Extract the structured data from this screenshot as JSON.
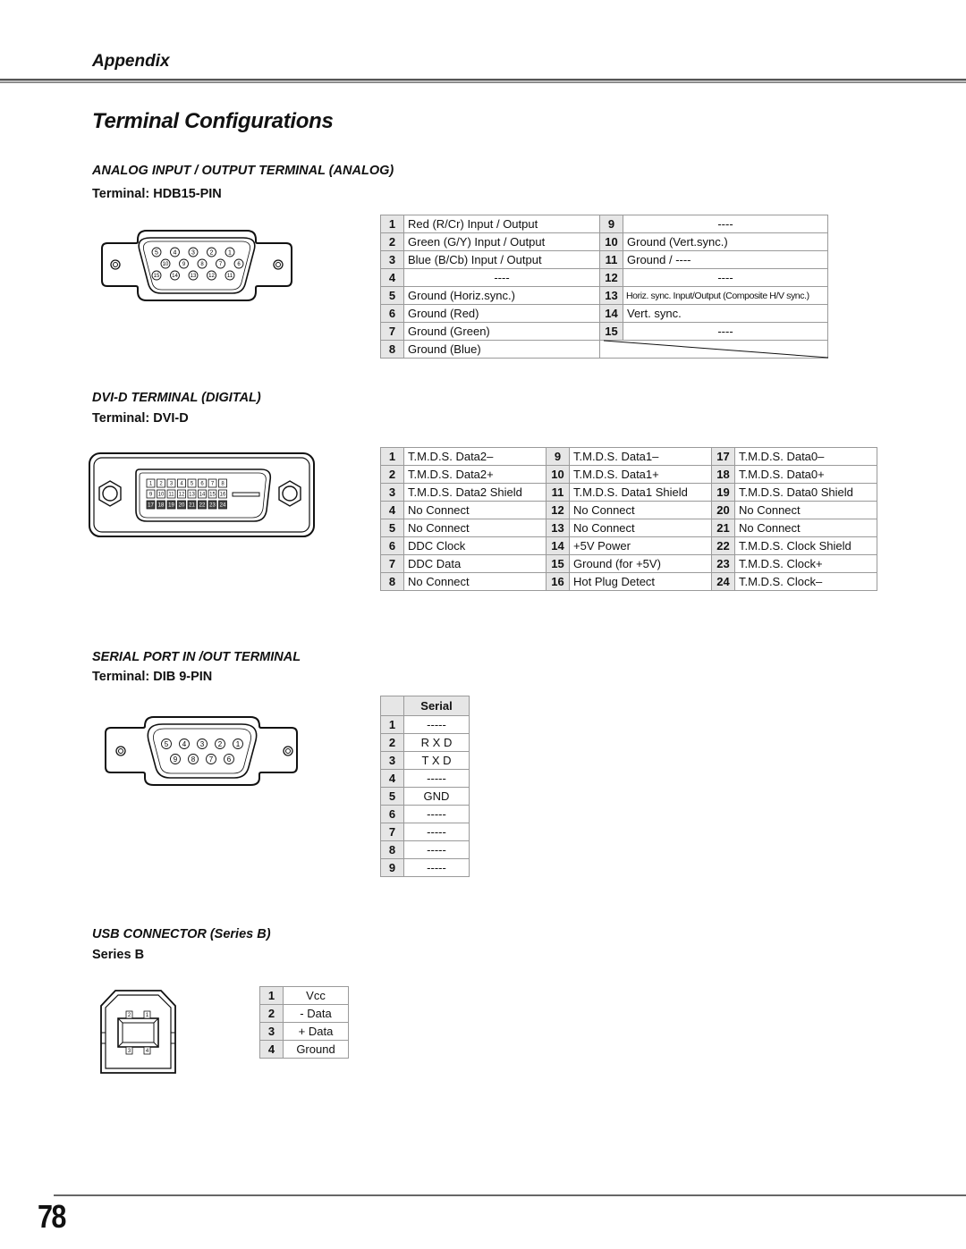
{
  "header": {
    "section": "Appendix",
    "page_title": "Terminal Configurations"
  },
  "analog": {
    "title": "ANALOG INPUT / OUTPUT TERMINAL (ANALOG)",
    "terminal": "Terminal: HDB15-PIN",
    "connector_pins_row1": [
      "5",
      "4",
      "3",
      "2",
      "1"
    ],
    "connector_pins_row2": [
      "10",
      "9",
      "8",
      "7",
      "6"
    ],
    "connector_pins_row3": [
      "15",
      "14",
      "13",
      "12",
      "11"
    ],
    "pins": [
      {
        "num": "1",
        "desc": "Red (R/Cr) Input / Output"
      },
      {
        "num": "2",
        "desc": "Green (G/Y) Input / Output"
      },
      {
        "num": "3",
        "desc": "Blue (B/Cb) Input / Output"
      },
      {
        "num": "4",
        "desc": "----"
      },
      {
        "num": "5",
        "desc": "Ground (Horiz.sync.)"
      },
      {
        "num": "6",
        "desc": "Ground (Red)"
      },
      {
        "num": "7",
        "desc": "Ground (Green)"
      },
      {
        "num": "8",
        "desc": "Ground (Blue)"
      },
      {
        "num": "9",
        "desc": "----"
      },
      {
        "num": "10",
        "desc": "Ground (Vert.sync.)"
      },
      {
        "num": "11",
        "desc": "Ground /  ----"
      },
      {
        "num": "12",
        "desc": "----"
      },
      {
        "num": "13",
        "desc": "Horiz. sync. Input/Output (Composite H/V sync.)"
      },
      {
        "num": "14",
        "desc": "Vert. sync."
      },
      {
        "num": "15",
        "desc": "----"
      }
    ]
  },
  "dvi": {
    "title": "DVI-D TERMINAL (DIGITAL)",
    "terminal": "Terminal: DVI-D",
    "pins": [
      {
        "num": "1",
        "desc": "T.M.D.S. Data2–"
      },
      {
        "num": "2",
        "desc": "T.M.D.S. Data2+"
      },
      {
        "num": "3",
        "desc": "T.M.D.S. Data2 Shield"
      },
      {
        "num": "4",
        "desc": "No Connect"
      },
      {
        "num": "5",
        "desc": "No Connect"
      },
      {
        "num": "6",
        "desc": "DDC Clock"
      },
      {
        "num": "7",
        "desc": "DDC Data"
      },
      {
        "num": "8",
        "desc": "No Connect"
      },
      {
        "num": "9",
        "desc": "T.M.D.S. Data1–"
      },
      {
        "num": "10",
        "desc": "T.M.D.S. Data1+"
      },
      {
        "num": "11",
        "desc": "T.M.D.S. Data1 Shield"
      },
      {
        "num": "12",
        "desc": "No Connect"
      },
      {
        "num": "13",
        "desc": "No Connect"
      },
      {
        "num": "14",
        "desc": "+5V Power"
      },
      {
        "num": "15",
        "desc": "Ground (for +5V)"
      },
      {
        "num": "16",
        "desc": "Hot Plug Detect"
      },
      {
        "num": "17",
        "desc": "T.M.D.S. Data0–"
      },
      {
        "num": "18",
        "desc": "T.M.D.S. Data0+"
      },
      {
        "num": "19",
        "desc": "T.M.D.S. Data0 Shield"
      },
      {
        "num": "20",
        "desc": "No Connect"
      },
      {
        "num": "21",
        "desc": "No Connect"
      },
      {
        "num": "22",
        "desc": "T.M.D.S. Clock Shield"
      },
      {
        "num": "23",
        "desc": "T.M.D.S. Clock+"
      },
      {
        "num": "24",
        "desc": "T.M.D.S. Clock–"
      }
    ]
  },
  "serial": {
    "title": "SERIAL PORT IN /OUT TERMINAL",
    "terminal": "Terminal: DIB 9-PIN",
    "column_header": "Serial",
    "connector_pins_row1": [
      "5",
      "4",
      "3",
      "2",
      "1"
    ],
    "connector_pins_row2": [
      "9",
      "8",
      "7",
      "6"
    ],
    "pins": [
      {
        "num": "1",
        "desc": "-----"
      },
      {
        "num": "2",
        "desc": "R X D"
      },
      {
        "num": "3",
        "desc": "T X D"
      },
      {
        "num": "4",
        "desc": "-----"
      },
      {
        "num": "5",
        "desc": "GND"
      },
      {
        "num": "6",
        "desc": "-----"
      },
      {
        "num": "7",
        "desc": "-----"
      },
      {
        "num": "8",
        "desc": "-----"
      },
      {
        "num": "9",
        "desc": "-----"
      }
    ]
  },
  "usb": {
    "title": "USB CONNECTOR (Series B)",
    "terminal": "Series B",
    "connector_pins": [
      "2",
      "1",
      "3",
      "4"
    ],
    "pins": [
      {
        "num": "1",
        "desc": "Vcc"
      },
      {
        "num": "2",
        "desc": "- Data"
      },
      {
        "num": "3",
        "desc": "+ Data"
      },
      {
        "num": "4",
        "desc": "Ground"
      }
    ]
  },
  "footer": {
    "page_number": "78"
  }
}
